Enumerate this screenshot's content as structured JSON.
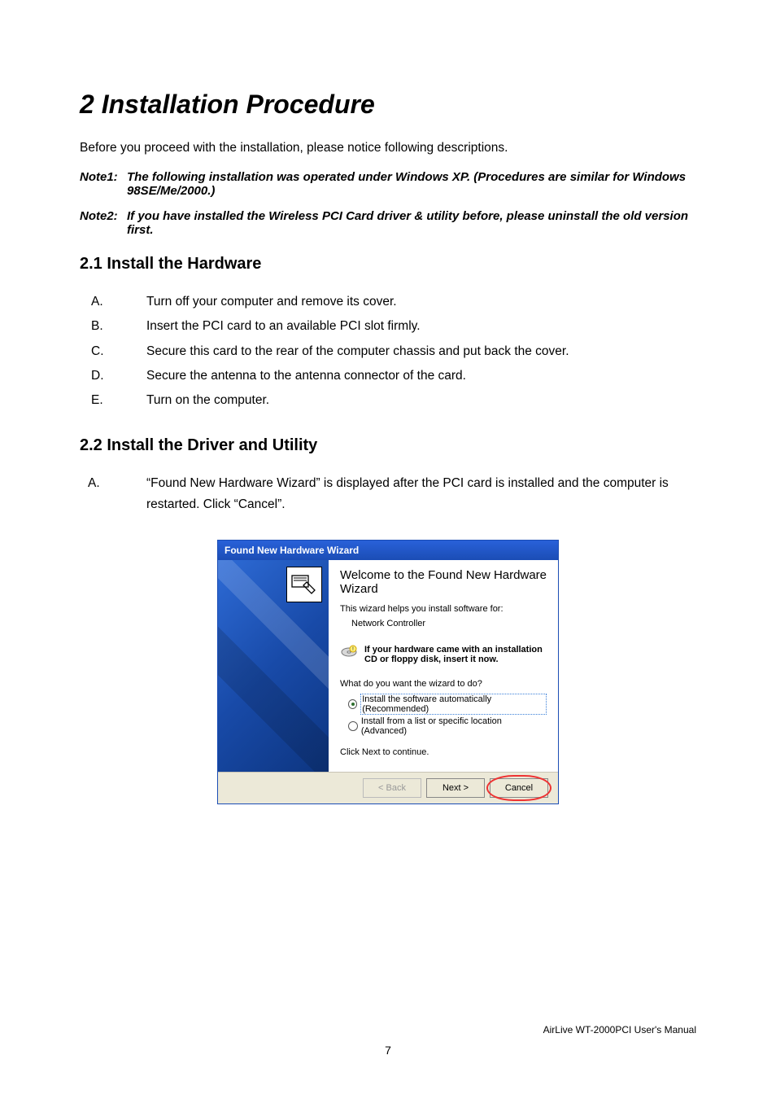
{
  "chapter_title": "2 Installation Procedure",
  "intro": "Before you proceed with the installation, please notice following descriptions.",
  "notes": [
    {
      "label": "Note1:",
      "text": "The following installation was operated under Windows XP.    (Procedures are similar for Windows 98SE/Me/2000.)"
    },
    {
      "label": "Note2:",
      "text": "If you have installed the Wireless PCI Card driver & utility before, please uninstall the old version first."
    }
  ],
  "section21": {
    "title": "2.1 Install the Hardware",
    "items": [
      {
        "letter": "A.",
        "text": "Turn off your computer and remove its cover."
      },
      {
        "letter": "B.",
        "text": "Insert the PCI card to an available PCI slot firmly."
      },
      {
        "letter": "C.",
        "text": "Secure this card to the rear of the computer chassis and put back the cover."
      },
      {
        "letter": "D.",
        "text": "Secure the antenna to the antenna connector of the card."
      },
      {
        "letter": "E.",
        "text": "Turn on the computer."
      }
    ]
  },
  "section22": {
    "title": "2.2 Install the Driver and Utility",
    "items": [
      {
        "letter": "A.",
        "text": "“Found New Hardware Wizard” is displayed after the PCI card is installed and the computer is restarted. Click “Cancel”."
      }
    ]
  },
  "wizard": {
    "titlebar": "Found New Hardware Wizard",
    "heading": "Welcome to the Found New Hardware Wizard",
    "helps": "This wizard helps you install software for:",
    "device": "Network Controller",
    "cd_text": "If your hardware came with an installation CD or floppy disk, insert it now.",
    "question": "What do you want the wizard to do?",
    "radio1": "Install the software automatically (Recommended)",
    "radio2": "Install from a list or specific location (Advanced)",
    "cont": "Click Next to continue.",
    "btn_back": "< Back",
    "btn_next": "Next >",
    "btn_cancel": "Cancel"
  },
  "footer_brand": "AirLive WT-2000PCI User's Manual",
  "page_number": "7"
}
